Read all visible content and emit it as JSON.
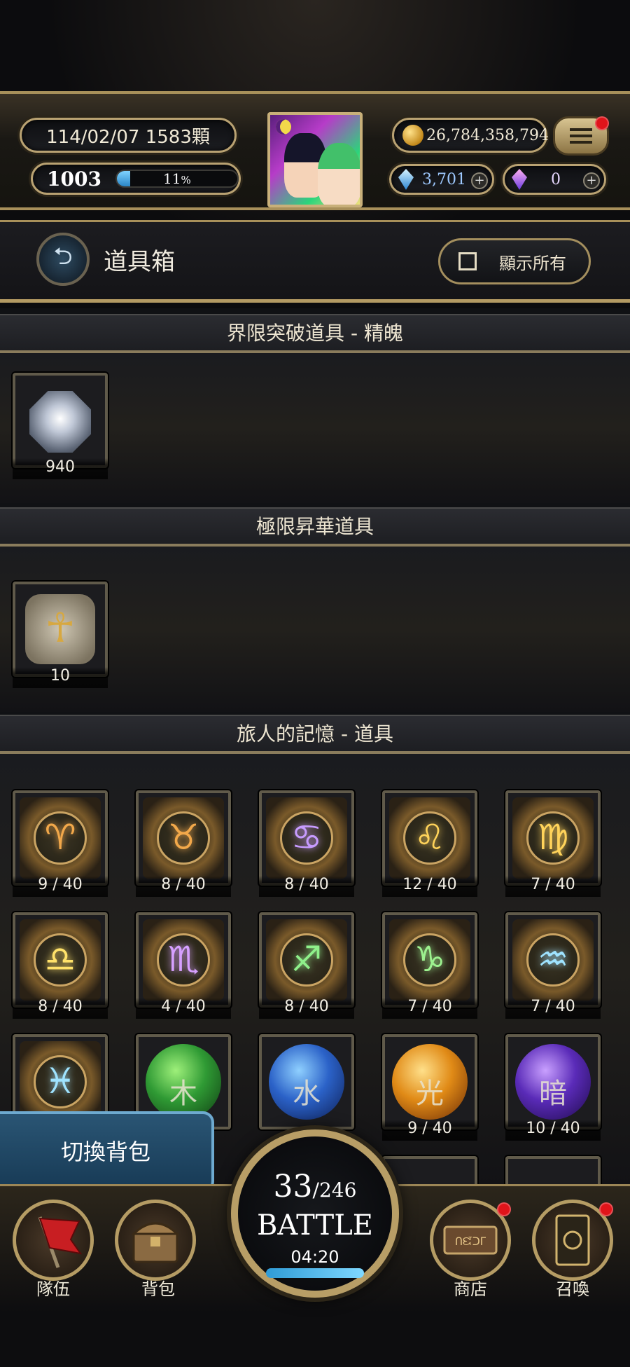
{
  "status": {
    "date_text": "114/02/07 1583顆",
    "player_level": "1003",
    "xp_percent_label": "11",
    "xp_percent_unit": "%",
    "xp_progress": 0.11,
    "gold": "26,784,358,794",
    "gems_blue": "3,701",
    "gems_purple": "0",
    "plus": "+"
  },
  "header": {
    "title": "道具箱",
    "show_all_label": "顯示所有"
  },
  "sections": [
    {
      "title": "界限突破道具 - 精魄",
      "items": [
        {
          "count": "940",
          "icon": "crystal-essence"
        }
      ]
    },
    {
      "title": "極限昇華道具",
      "items": [
        {
          "count": "10",
          "icon": "ankh-stone"
        }
      ]
    },
    {
      "title": "旅人的記憶 - 道具",
      "items": [
        {
          "glyph": "♈",
          "count": "9 / 40",
          "color": "#f2a84a"
        },
        {
          "glyph": "♉",
          "count": "8 / 40",
          "color": "#f2a84a"
        },
        {
          "glyph": "♋",
          "count": "8 / 40",
          "color": "#c79bff"
        },
        {
          "glyph": "♌",
          "count": "12 / 40",
          "color": "#ffd35a"
        },
        {
          "glyph": "♍",
          "count": "7 / 40",
          "color": "#ffd35a"
        },
        {
          "glyph": "♎",
          "count": "8 / 40",
          "color": "#ffe26a"
        },
        {
          "glyph": "♏",
          "count": "4 / 40",
          "color": "#d6a0ff"
        },
        {
          "glyph": "♐",
          "count": "8 / 40",
          "color": "#8ff08a"
        },
        {
          "glyph": "♑",
          "count": "7 / 40",
          "color": "#9df28f"
        },
        {
          "glyph": "♒",
          "count": "7 / 40",
          "color": "#9fe3ff"
        },
        {
          "glyph": "♓",
          "count": "",
          "color": "#9fe3ff"
        },
        {
          "glyph": "木",
          "count": "",
          "orb": "green"
        },
        {
          "glyph": "水",
          "count": "",
          "orb": "blue"
        },
        {
          "glyph": "光",
          "count": "9 / 40",
          "orb": "orange"
        },
        {
          "glyph": "暗",
          "count": "10 / 40",
          "orb": "purple"
        }
      ]
    }
  ],
  "switch_bag_label": "切換背包",
  "battle": {
    "current": "33",
    "total": "/246",
    "label": "BATTLE",
    "timer": "04:20"
  },
  "nav": {
    "team": "隊伍",
    "bag": "背包",
    "shop": "商店",
    "shop_sign": "ᑎᘿᑐᒥ",
    "summon": "召喚"
  },
  "colors": {
    "gold_border": "#b9a272",
    "badge_red": "#e0141a",
    "battle_bar": "#2f9bd6"
  }
}
